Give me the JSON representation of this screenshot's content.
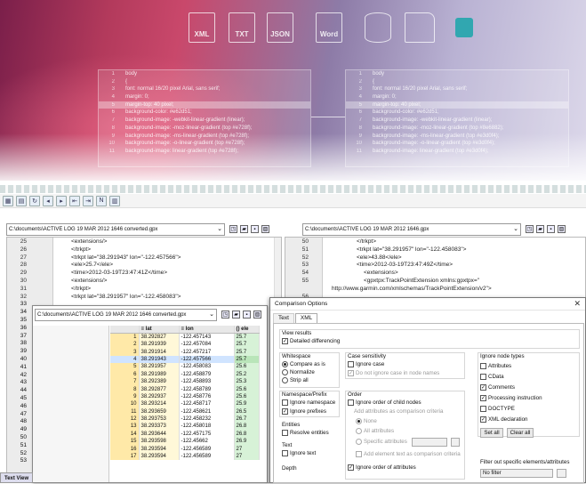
{
  "banner": {
    "file_icons": [
      "XML",
      "TXT",
      "JSON",
      "Word"
    ],
    "left_code": [
      {
        "n": "1",
        "t": "body"
      },
      {
        "n": "2",
        "t": "{"
      },
      {
        "n": "3",
        "t": "font: normal 16/20 pixel Arial, sans serif;"
      },
      {
        "n": "4",
        "t": "margin: 0;"
      },
      {
        "n": "5",
        "t": "margin-top: 40 pixel;"
      },
      {
        "n": "6",
        "t": "background-color: #e62d51;"
      },
      {
        "n": "7",
        "t": "background-image: -webkit-linear-gradient (linear);"
      },
      {
        "n": "8",
        "t": "background-image: -moz-linear-gradient (top #e728f);"
      },
      {
        "n": "9",
        "t": "background-image: -ms-linear-gradient (top #e728f);"
      },
      {
        "n": "10",
        "t": "background-image: -o-linear-gradient (top #e728f);"
      },
      {
        "n": "11",
        "t": "background-image: linear-gradient (top #e728f);"
      }
    ],
    "right_code": [
      {
        "n": "1",
        "t": "body"
      },
      {
        "n": "2",
        "t": "{"
      },
      {
        "n": "3",
        "t": "font: normal 16/20 pixel Arial, sans serif;"
      },
      {
        "n": "4",
        "t": "margin: 0;"
      },
      {
        "n": "5",
        "t": "margin-top: 40 pixel;"
      },
      {
        "n": "6",
        "t": "background-color: #e62d51;"
      },
      {
        "n": "7",
        "t": "background-image: -webkit-linear-gradient (linear);"
      },
      {
        "n": "8",
        "t": "background-image: -moz-linear-gradient (top #8e6882);"
      },
      {
        "n": "9",
        "t": "background-image: -ms-linear-gradient (top #e3d0f4);"
      },
      {
        "n": "10",
        "t": "background-image: -o-linear-gradient (top #e3d0f4);"
      },
      {
        "n": "11",
        "t": "background-image: linear-gradient (top #e3d0f4);"
      }
    ]
  },
  "left_path": "C:\\documents\\ACTIVE LOG 19 MAR 2012 1646 converted.gpx",
  "right_path": "C:\\documents\\ACTIVE LOG 19 MAR 2012 1646.gpx",
  "left_editor": [
    {
      "n": "25",
      "c": "<extensions/>"
    },
    {
      "n": "26",
      "c": "</trkpt>"
    },
    {
      "n": "27",
      "c": "<trkpt lat=\"38.291943\" lon=\"-122.457566\">"
    },
    {
      "n": "28",
      "c": "<ele>25.7</ele>"
    },
    {
      "n": "29",
      "c": "<time>2012-03-19T23:47:41Z</time>"
    },
    {
      "n": "30",
      "c": "<extensions/>"
    },
    {
      "n": "31",
      "c": "</trkpt>"
    },
    {
      "n": "32",
      "c": "<trkpt lat=\"38.291957\" lon=\"-122.458083\">"
    }
  ],
  "left_more_nums": [
    "33",
    "34",
    "35",
    "36",
    "37",
    "38",
    "39",
    "40",
    "41",
    "42",
    "43",
    "44",
    "45",
    "46",
    "47",
    "48",
    "49",
    "50",
    "51",
    "52",
    "53"
  ],
  "right_editor": [
    {
      "n": "50",
      "c": "</trkpt>"
    },
    {
      "n": "51",
      "c": "<trkpt lat=\"38.291957\" lon=\"-122.458083\">"
    },
    {
      "n": "52",
      "c": "<ele>43.88</ele>"
    },
    {
      "n": "53",
      "c": "<time>2012-03-19T23:47:49Z</time>"
    },
    {
      "n": "54",
      "c": "<extensions>"
    },
    {
      "n": "55",
      "c": "<gpxtpx:TrackPointExtension xmlns:gpxtpx=\""
    },
    {
      "n": "",
      "c": "http://www.garmin.com/xmlschemas/TrackPointExtension/v2\">"
    },
    {
      "n": "56",
      "c": ""
    }
  ],
  "grid": {
    "path": "C:\\documents\\ACTIVE LOG 19 MAR 2012 1646 converted.gpx",
    "headers": [
      "",
      "lat",
      "lon",
      "ele"
    ],
    "rows": [
      [
        "1",
        "38.292827",
        "-122.457143",
        "25.7"
      ],
      [
        "2",
        "38.291939",
        "-122.457084",
        "25.7"
      ],
      [
        "3",
        "38.291914",
        "-122.457217",
        "25.7"
      ],
      [
        "4",
        "38.291943",
        "-122.457566",
        "25.7"
      ],
      [
        "5",
        "38.291957",
        "-122.458083",
        "25.6"
      ],
      [
        "6",
        "38.291989",
        "-122.458879",
        "25.2"
      ],
      [
        "7",
        "38.292389",
        "-122.458893",
        "25.3"
      ],
      [
        "8",
        "38.292877",
        "-122.458789",
        "25.6"
      ],
      [
        "9",
        "38.292937",
        "-122.458776",
        "25.6"
      ],
      [
        "10",
        "38.293214",
        "-122.458717",
        "25.9"
      ],
      [
        "11",
        "38.293659",
        "-122.458621",
        "26.5"
      ],
      [
        "12",
        "38.293753",
        "-122.458232",
        "26.7"
      ],
      [
        "13",
        "38.293373",
        "-122.458018",
        "26.8"
      ],
      [
        "14",
        "38.293644",
        "-122.457175",
        "26.8"
      ],
      [
        "15",
        "38.293598",
        "-122.45662",
        "26.9"
      ],
      [
        "16",
        "38.293594",
        "-122.456589",
        "27"
      ],
      [
        "17",
        "38.293594",
        "-122.456589",
        "27"
      ]
    ]
  },
  "status_tab": "Text View",
  "dialog": {
    "title": "Comparison Options",
    "tabs": [
      "Text",
      "XML"
    ],
    "view_results": "View results",
    "detailed": "Detailed differencing",
    "whitespace": "Whitespace",
    "ws_opts": [
      "Compare as is",
      "Normalize",
      "Strip all"
    ],
    "namespace": "Namespace/Prefix",
    "ignore_ns": "Ignore namespace",
    "ignore_prefixes": "Ignore prefixes",
    "entities": "Entities",
    "resolve_entities": "Resolve entities",
    "text": "Text",
    "ignore_text": "Ignore text",
    "depth": "Depth",
    "case": "Case sensitivity",
    "ignore_case": "Ignore case",
    "dont_ignore": "Do not ignore case in node names",
    "order": "Order",
    "ignore_child_order": "Ignore order of child nodes",
    "add_attr": "Add attributes as comparison criteria",
    "none": "None",
    "all_attr": "All attributes",
    "specific_attr": "Specific attributes",
    "add_elem": "Add element text as comparison criteria",
    "ignore_attr_order": "Ignore order of attributes",
    "node_types": "Ignore node types",
    "nt_opts": [
      "Attributes",
      "CData",
      "Comments",
      "Processing instruction",
      "DOCTYPE",
      "XML declaration"
    ],
    "set_all": "Set all",
    "clear_all": "Clear all",
    "filter": "Filter out specific elements/attributes",
    "filter_sel": "No filter"
  }
}
